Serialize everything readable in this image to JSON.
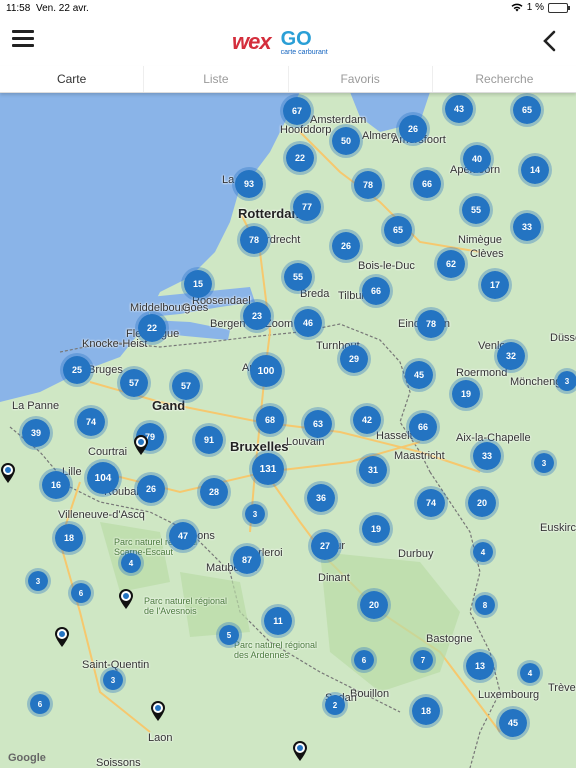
{
  "status": {
    "time": "11:58",
    "date": "Ven. 22 avr.",
    "battery": "1 %"
  },
  "header": {
    "logo_text": "wex",
    "logo_go": "GO",
    "logo_sub": "carte carburant"
  },
  "tabs": [
    {
      "label": "Carte"
    },
    {
      "label": "Liste"
    },
    {
      "label": "Favoris"
    },
    {
      "label": "Recherche"
    }
  ],
  "map": {
    "attribution": "Google",
    "places": [
      {
        "name": "Amsterdam",
        "big": false
      },
      {
        "name": "Hoofddorp",
        "big": false
      },
      {
        "name": "Almere",
        "big": false
      },
      {
        "name": "Amersfoort",
        "big": false
      },
      {
        "name": "Apeldoorn",
        "big": false
      },
      {
        "name": "La Haye",
        "big": false
      },
      {
        "name": "Rotterdam",
        "big": true
      },
      {
        "name": "Dordrecht",
        "big": false
      },
      {
        "name": "Nimègue",
        "big": false
      },
      {
        "name": "Bois-le-Duc",
        "big": false
      },
      {
        "name": "Middelbourg",
        "big": false
      },
      {
        "name": "Goes",
        "big": false
      },
      {
        "name": "Breda",
        "big": false
      },
      {
        "name": "Tilburg",
        "big": false
      },
      {
        "name": "Eindhoven",
        "big": false
      },
      {
        "name": "Venlo",
        "big": false
      },
      {
        "name": "Bruges",
        "big": false
      },
      {
        "name": "Anvers",
        "big": false
      },
      {
        "name": "Gand",
        "big": true
      },
      {
        "name": "Bruxelles",
        "big": true
      },
      {
        "name": "Louvain",
        "big": false
      },
      {
        "name": "Hasselt",
        "big": false
      },
      {
        "name": "Maastricht",
        "big": false
      },
      {
        "name": "Aix-la-Chapelle",
        "big": false
      },
      {
        "name": "Courtrai",
        "big": false
      },
      {
        "name": "Lille",
        "big": false
      },
      {
        "name": "Roubaix",
        "big": false
      },
      {
        "name": "Villeneuve-d'Ascq",
        "big": false
      },
      {
        "name": "Mons",
        "big": false
      },
      {
        "name": "Charleroi",
        "big": false
      },
      {
        "name": "Namur",
        "big": false
      },
      {
        "name": "Maubeuge",
        "big": false
      },
      {
        "name": "Dinant",
        "big": false
      },
      {
        "name": "Durbuy",
        "big": false
      },
      {
        "name": "Bastogne",
        "big": false
      },
      {
        "name": "Bouillon",
        "big": false
      },
      {
        "name": "Luxembourg",
        "big": false
      },
      {
        "name": "Saint-Quentin",
        "big": false
      },
      {
        "name": "Parc naturel régional Scarpe-Escaut",
        "big": false
      },
      {
        "name": "Parc naturel régional de l'Avesnois",
        "big": false
      },
      {
        "name": "Parc naturel régional des Ardennes",
        "big": false
      },
      {
        "name": "La Panne",
        "big": false
      },
      {
        "name": "Knocke-Heist",
        "big": false
      },
      {
        "name": "Flessingue",
        "big": false
      },
      {
        "name": "Roosendael",
        "big": false
      },
      {
        "name": "Bergen-op-Zoom",
        "big": false
      },
      {
        "name": "Turnhout",
        "big": false
      },
      {
        "name": "Roermond",
        "big": false
      },
      {
        "name": "Mönchengladbach",
        "big": false
      },
      {
        "name": "Düsseldorf",
        "big": false
      },
      {
        "name": "Euskirchen",
        "big": false
      },
      {
        "name": "Trèves",
        "big": false
      },
      {
        "name": "Clèves",
        "big": false
      },
      {
        "name": "Soissons",
        "big": false
      },
      {
        "name": "Laon",
        "big": false
      },
      {
        "name": "Sedan",
        "big": false
      }
    ],
    "clusters": [
      "67",
      "50",
      "43",
      "65",
      "26",
      "22",
      "40",
      "14",
      "93",
      "78",
      "66",
      "55",
      "77",
      "33",
      "78",
      "26",
      "65",
      "62",
      "17",
      "15",
      "55",
      "66",
      "22",
      "23",
      "46",
      "78",
      "25",
      "57",
      "57",
      "100",
      "29",
      "45",
      "32",
      "19",
      "3",
      "74",
      "39",
      "79",
      "91",
      "68",
      "63",
      "42",
      "66",
      "33",
      "131",
      "31",
      "3",
      "104",
      "16",
      "26",
      "28",
      "36",
      "74",
      "20",
      "18",
      "47",
      "3",
      "19",
      "87",
      "27",
      "4",
      "3",
      "6",
      "4",
      "8",
      "20",
      "5",
      "11",
      "6",
      "7",
      "13",
      "4",
      "3",
      "2",
      "18",
      "45",
      "6"
    ],
    "pins": [
      "station-pin",
      "station-pin",
      "station-pin",
      "station-pin",
      "station-pin",
      "station-pin"
    ]
  }
}
